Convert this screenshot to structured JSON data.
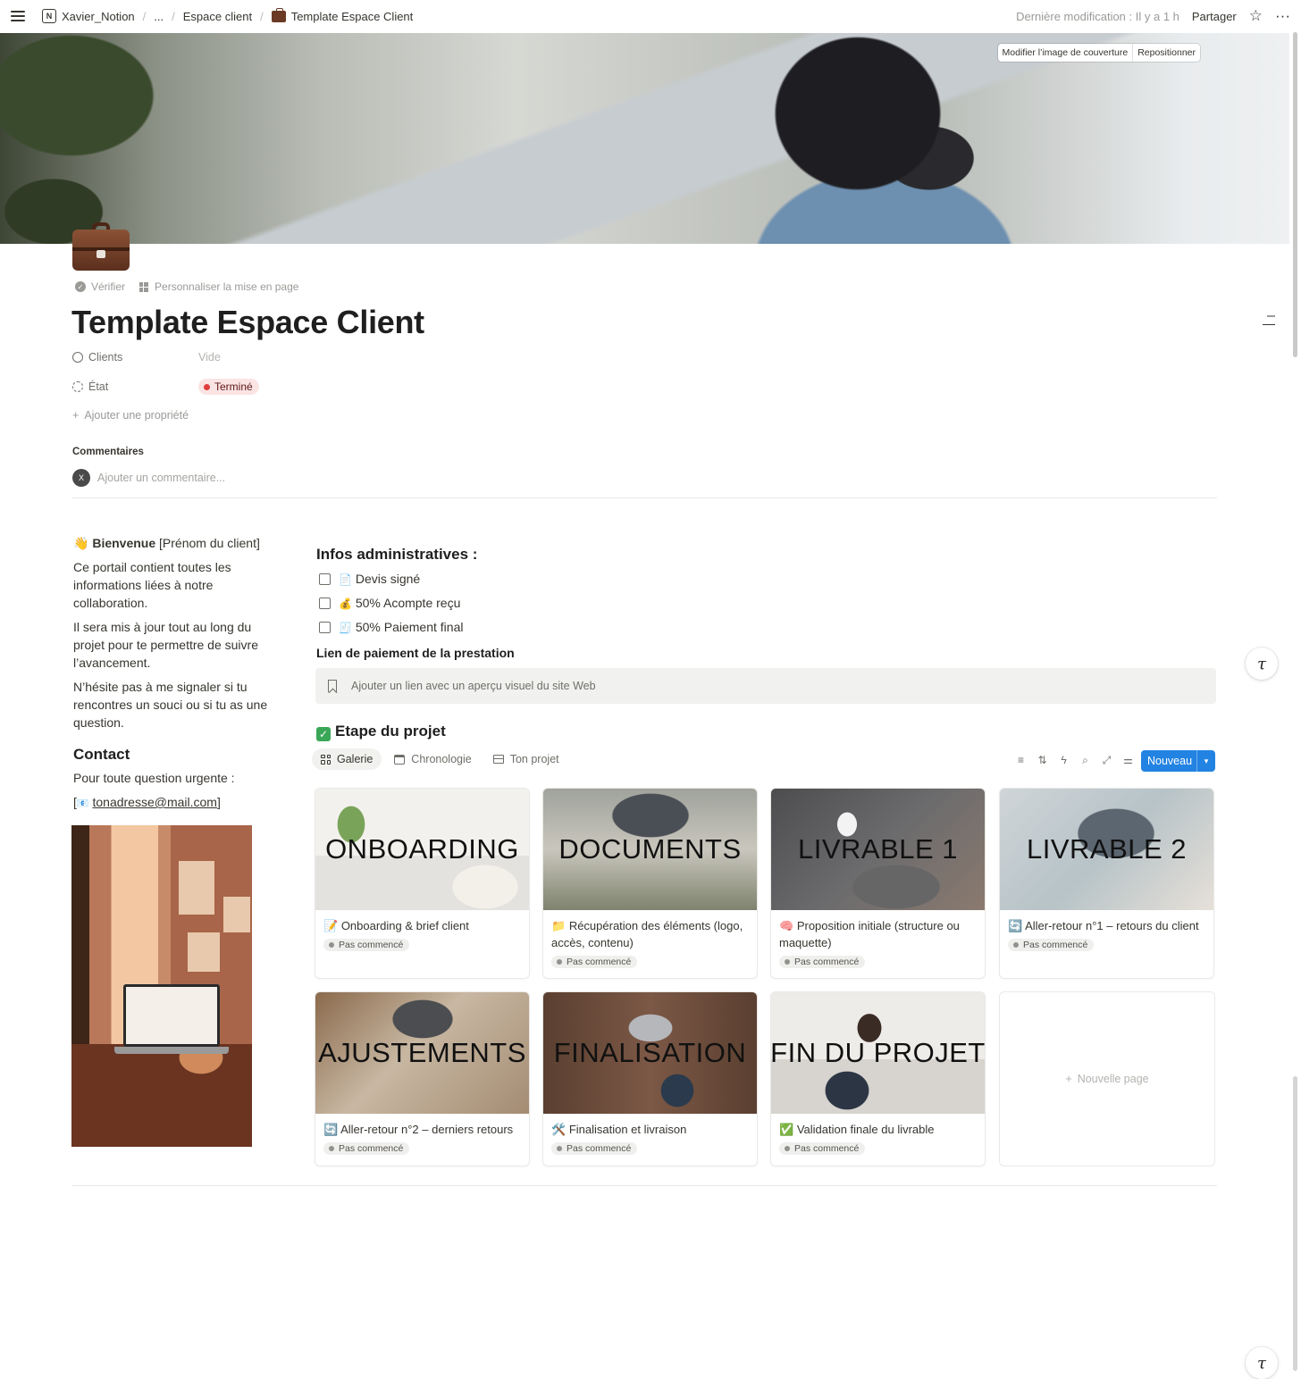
{
  "breadcrumb": {
    "workspace": "Xavier_Notion",
    "ellipsis": "...",
    "parent": "Espace client",
    "current": "Template Espace Client"
  },
  "topbar": {
    "last_modified": "Dernière modification : Il y a 1 h",
    "share": "Partager",
    "star_icon": "☆",
    "more_icon": "···"
  },
  "cover": {
    "change": "Modifier l’image de couverture",
    "reposition": "Repositionner"
  },
  "page_actions": {
    "verify": "Vérifier",
    "customize": "Personnaliser la mise en page"
  },
  "page": {
    "title": "Template Espace Client"
  },
  "properties": {
    "clients": {
      "name": "Clients",
      "value": "Vide"
    },
    "state": {
      "name": "État",
      "value": "Terminé",
      "color": "#e03e3e"
    },
    "add": "Ajouter une propriété",
    "add_icon": "+"
  },
  "comments": {
    "heading": "Commentaires",
    "avatar": "X",
    "placeholder": "Ajouter un commentaire..."
  },
  "welcome": {
    "emoji": "👋",
    "bold": "Bienvenue",
    "name": "[Prénom du client]",
    "p1": "Ce portail contient toutes les informations liées à notre collaboration.",
    "p2": "Il sera mis à jour tout au long du projet pour te permettre de suivre l’avancement.",
    "p3": "N’hésite pas à me signaler si tu rencontres un souci ou si tu as une question."
  },
  "contact": {
    "heading": "Contact",
    "text": "Pour toute question urgente :",
    "open_bracket": "[",
    "email_emoji": "📧",
    "email": "tonadresse@mail.com",
    "close_bracket": "]"
  },
  "admin": {
    "heading": "Infos administratives :",
    "todos": [
      {
        "emoji": "📄",
        "label": "Devis signé"
      },
      {
        "emoji": "💰",
        "label": "50% Acompte reçu"
      },
      {
        "emoji": "🧾",
        "label": "50% Paiement final"
      }
    ],
    "payment_heading": "Lien de paiement de la prestation",
    "bookmark_placeholder": "Ajouter un lien avec un aperçu visuel du site Web"
  },
  "project": {
    "check": "✓",
    "heading": "Etape du projet",
    "tabs": [
      "Galerie",
      "Chronologie",
      "Ton projet"
    ],
    "tools": [
      "≡",
      "⇅",
      "ϟ",
      "⌕",
      "⤢",
      "⚌"
    ],
    "new_button": "Nouveau",
    "new_arrow": "▾",
    "new_page": "Nouvelle page",
    "new_page_icon": "+",
    "cards": [
      {
        "cover_text": "ONBOARDING",
        "emoji": "📝",
        "title": "Onboarding & brief client",
        "status": "Pas commencé"
      },
      {
        "cover_text": "DOCUMENTS",
        "emoji": "📁",
        "title": "Récupération des éléments (logo, accès, contenu)",
        "status": "Pas commencé"
      },
      {
        "cover_text": "LIVRABLE 1",
        "emoji": "🧠",
        "title": "Proposition initiale (structure ou maquette)",
        "status": "Pas commencé"
      },
      {
        "cover_text": "LIVRABLE 2",
        "emoji": "🔄",
        "title": "Aller-retour n°1 – retours du client",
        "status": "Pas commencé"
      },
      {
        "cover_text": "AJUSTEMENTS",
        "emoji": "🔄",
        "title": "Aller-retour n°2 – derniers retours",
        "status": "Pas commencé"
      },
      {
        "cover_text": "FINALISATION",
        "emoji": "🛠️",
        "title": "Finalisation et livraison",
        "status": "Pas commencé"
      },
      {
        "cover_text": "FIN DU PROJET",
        "emoji": "✅",
        "title": "Validation finale du livrable",
        "status": "Pas commencé"
      }
    ]
  },
  "colors": {
    "accent": "#2383e2",
    "status_done": "#e03e3e",
    "text": "#37352f"
  }
}
